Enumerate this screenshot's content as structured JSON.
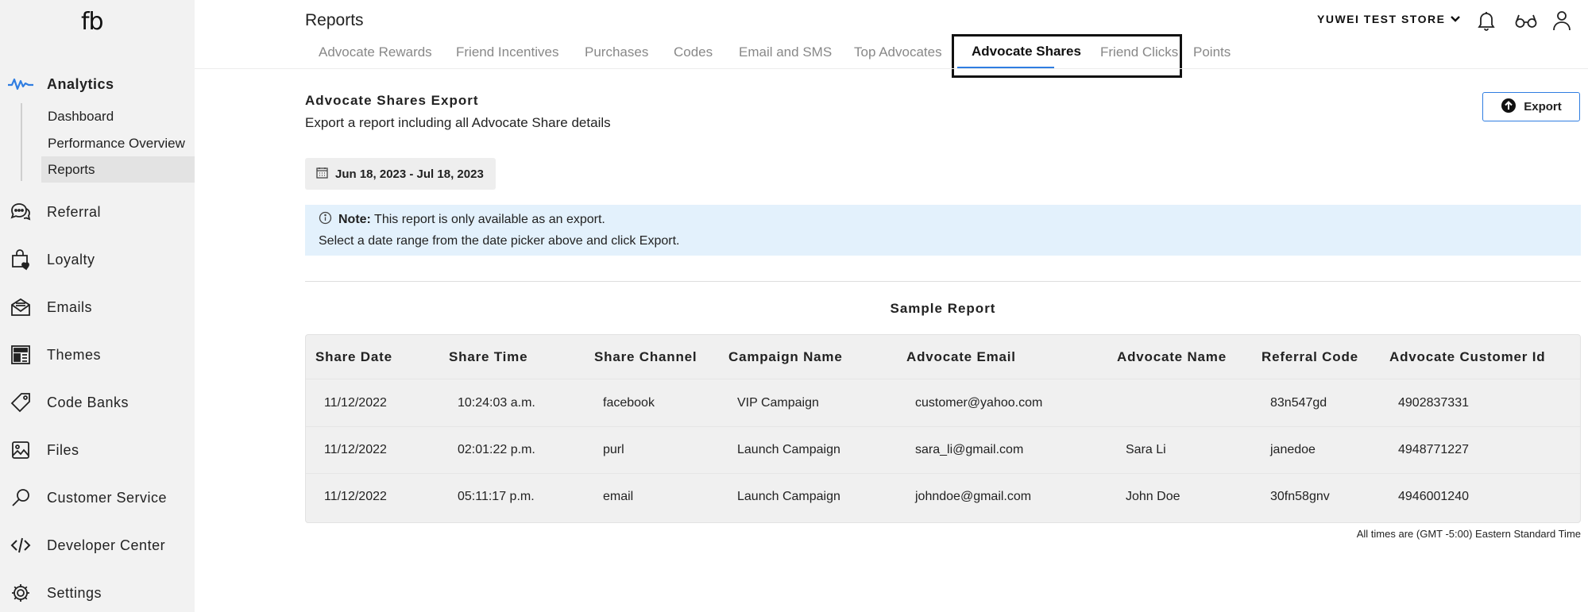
{
  "sidebar": {
    "logo": "fb",
    "analytics": {
      "label": "Analytics",
      "sub_items": [
        "Dashboard",
        "Performance Overview",
        "Reports"
      ]
    },
    "items": [
      {
        "label": "Referral",
        "icon": "chat-bubbles-icon"
      },
      {
        "label": "Loyalty",
        "icon": "shopping-bag-heart-icon"
      },
      {
        "label": "Emails",
        "icon": "envelope-icon"
      },
      {
        "label": "Themes",
        "icon": "layout-icon"
      },
      {
        "label": "Code Banks",
        "icon": "tag-icon"
      },
      {
        "label": "Files",
        "icon": "image-icon"
      },
      {
        "label": "Customer Service",
        "icon": "magnifier-icon"
      },
      {
        "label": "Developer Center",
        "icon": "code-icon"
      },
      {
        "label": "Settings",
        "icon": "gear-icon"
      }
    ]
  },
  "header": {
    "title": "Reports",
    "store_name": "YUWEI TEST STORE",
    "tabs": [
      "Advocate Rewards",
      "Friend Incentives",
      "Purchases",
      "Codes",
      "Email and SMS",
      "Top Advocates",
      "Advocate Shares",
      "Friend Clicks",
      "Points"
    ],
    "active_tab": "Advocate Shares"
  },
  "section": {
    "title": "Advocate Shares Export",
    "subtitle": "Export a report including all Advocate Share details",
    "export_label": "Export",
    "date_range": "Jun 18, 2023 - Jul 18, 2023"
  },
  "note": {
    "bold": "Note:",
    "line1": "This report is only available as an export.",
    "line2": "Select a date range from the date picker above and click Export."
  },
  "report": {
    "title": "Sample Report",
    "columns": [
      "Share Date",
      "Share Time",
      "Share Channel",
      "Campaign Name",
      "Advocate Email",
      "Advocate Name",
      "Referral Code",
      "Advocate Customer Id"
    ],
    "rows": [
      [
        "11/12/2022",
        "10:24:03 a.m.",
        "facebook",
        "VIP Campaign",
        "customer@yahoo.com",
        "",
        "83n547gd",
        "4902837331"
      ],
      [
        "11/12/2022",
        "02:01:22 p.m.",
        "purl",
        "Launch Campaign",
        "sara_li@gmail.com",
        "Sara Li",
        "janedoe",
        "4948771227"
      ],
      [
        "11/12/2022",
        "05:11:17 p.m.",
        "email",
        "Launch Campaign",
        "johndoe@gmail.com",
        "John Doe",
        "30fn58gnv",
        "4946001240"
      ]
    ],
    "footnote": "All times are (GMT -5:00) Eastern Standard Time"
  },
  "colors": {
    "accent": "#2f7de1",
    "note_bg": "#e3f1fc",
    "sidebar_bg": "#f2f2f2"
  }
}
